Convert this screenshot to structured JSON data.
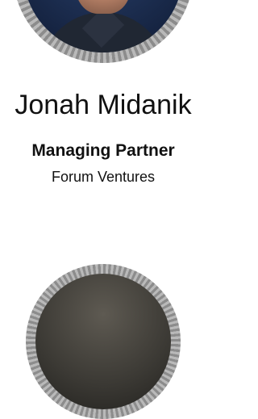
{
  "profile": {
    "name": "Jonah Midanik",
    "title": "Managing Partner",
    "company": "Forum Ventures"
  },
  "colors": {
    "text": "#111111",
    "avatar_ring": "#a3a3a3",
    "background": "#ffffff"
  }
}
